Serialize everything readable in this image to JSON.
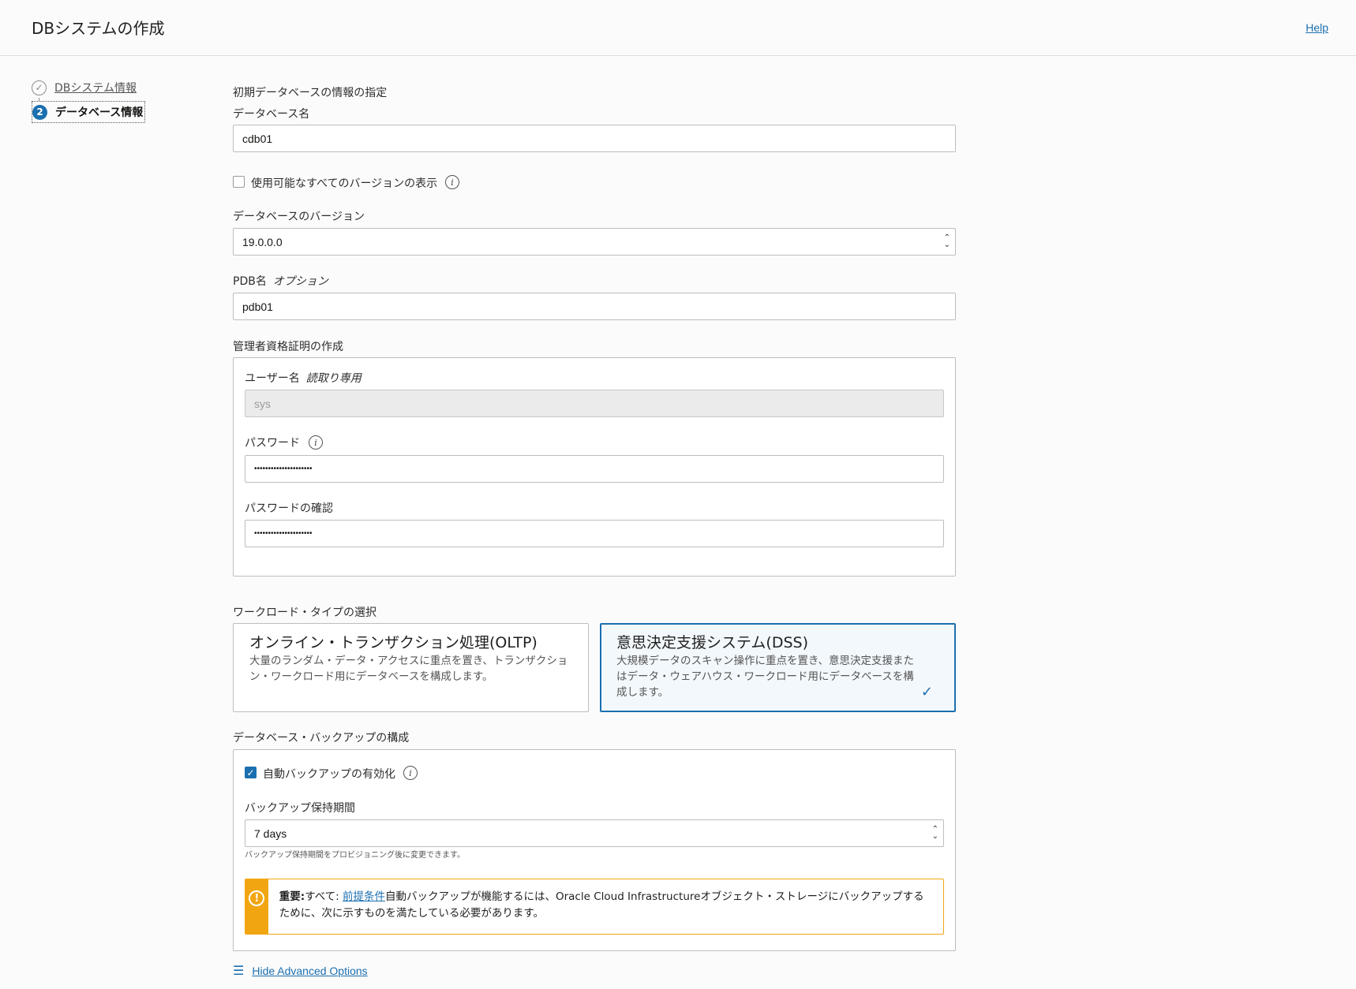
{
  "header": {
    "title": "DBシステムの作成",
    "help": "Help"
  },
  "steps": [
    {
      "num": "✓",
      "label": "DBシステム情報"
    },
    {
      "num": "2",
      "label": "データベース情報"
    }
  ],
  "form": {
    "section_title": "初期データベースの情報の指定",
    "db_name_label": "データベース名",
    "db_name_value": "cdb01",
    "show_versions_label": "使用可能なすべてのバージョンの表示",
    "version_label": "データベースのバージョン",
    "version_value": "19.0.0.0",
    "pdb_label": "PDB名",
    "pdb_optional": "オプション",
    "pdb_value": "pdb01",
    "admin_title": "管理者資格証明の作成",
    "username_label": "ユーザー名",
    "username_readonly": "読取り専用",
    "username_value": "sys",
    "password_label": "パスワード",
    "password_value": "•••••••••••••••••••••",
    "confirm_label": "パスワードの確認",
    "confirm_value": "•••••••••••••••••••••",
    "workload_title": "ワークロード・タイプの選択",
    "workload": [
      {
        "title": "オンライン・トランザクション処理(OLTP)",
        "desc": "大量のランダム・データ・アクセスに重点を置き、トランザクション・ワークロード用にデータベースを構成します。",
        "selected": false
      },
      {
        "title": "意思決定支援システム(DSS)",
        "desc": "大規模データのスキャン操作に重点を置き、意思決定支援またはデータ・ウェアハウス・ワークロード用にデータベースを構成します。",
        "selected": true
      }
    ],
    "backup_title": "データベース・バックアップの構成",
    "auto_backup_label": "自動バックアップの有効化",
    "retention_label": "バックアップ保持期間",
    "retention_value": "7 days",
    "retention_hint": "バックアップ保持期間をプロビジョニング後に変更できます。",
    "warning_bold": "重要:",
    "warning_all": "すべて: ",
    "warning_link": "前提条件",
    "warning_text": "自動バックアップが機能するには、Oracle Cloud Infrastructureオブジェクト・ストレージにバックアップするために、次に示すものを満たしている必要があります。",
    "advanced_link": "Hide Advanced Options"
  },
  "colors": {
    "accent": "#1a6fb0",
    "warning": "#f1a611"
  },
  "icons": {
    "info": "info-icon",
    "check": "checkmark-icon",
    "warning": "exclamation-icon",
    "settings": "sliders-icon"
  }
}
